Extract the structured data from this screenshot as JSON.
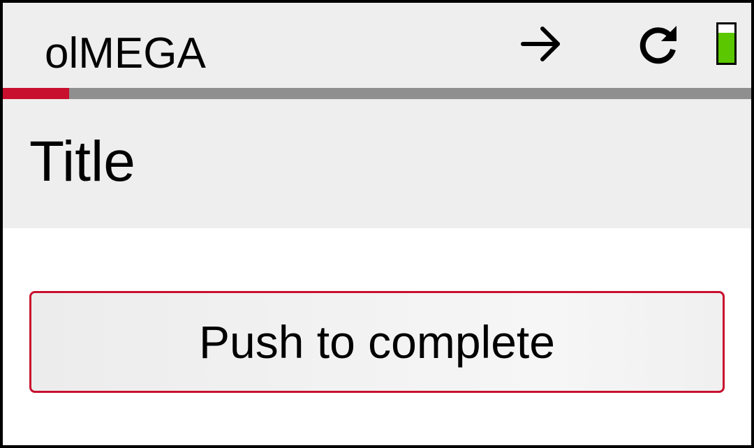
{
  "app_bar": {
    "title": "olMEGA",
    "forward_icon": "arrow-right-icon",
    "refresh_icon": "refresh-icon",
    "battery_icon": "battery-icon",
    "battery_level": 0.78,
    "battery_color": "#5ac700"
  },
  "progress": {
    "value": 0.089,
    "fill_color": "#c8102e",
    "track_color": "#8f8f8f"
  },
  "question": {
    "title": "Title"
  },
  "complete_button": {
    "label": "Push to complete",
    "border_color": "#c8102e"
  }
}
